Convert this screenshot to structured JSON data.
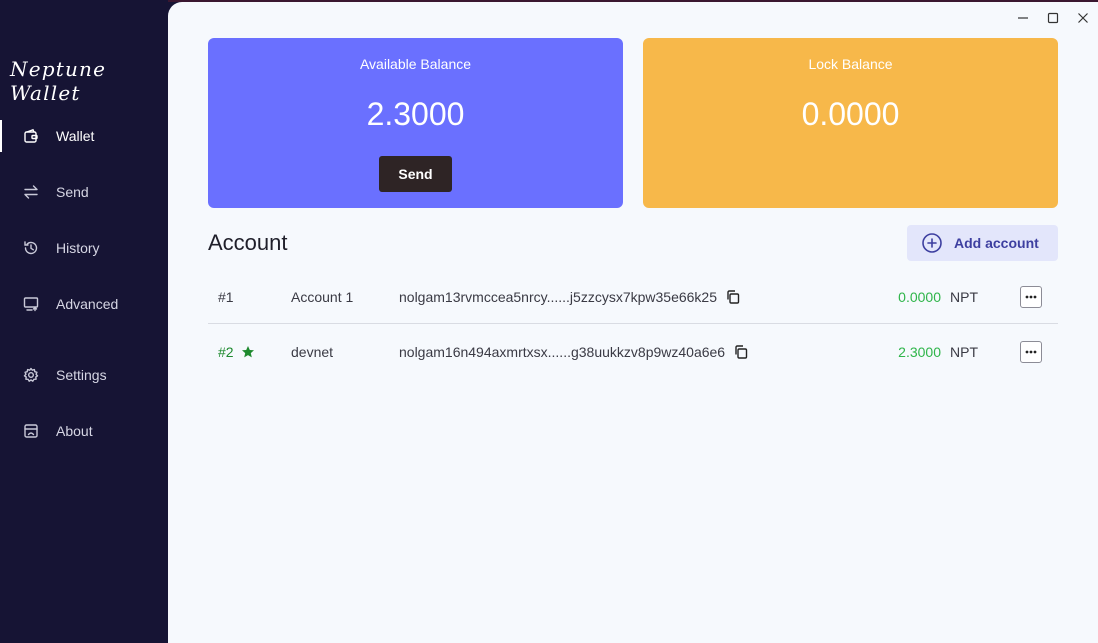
{
  "app": {
    "logo": "Neptune Wallet"
  },
  "sidebar": {
    "items": [
      {
        "label": "Wallet",
        "icon": "wallet-icon",
        "active": true
      },
      {
        "label": "Send",
        "icon": "transfer-arrows-icon"
      },
      {
        "label": "History",
        "icon": "history-icon"
      },
      {
        "label": "Advanced",
        "icon": "monitor-icon"
      },
      {
        "label": "Settings",
        "icon": "gear-icon"
      },
      {
        "label": "About",
        "icon": "about-icon"
      }
    ]
  },
  "window_controls": [
    "minimize-icon",
    "maximize-icon",
    "close-icon"
  ],
  "balances": {
    "available": {
      "title": "Available Balance",
      "amount": "2.3000",
      "send_label": "Send",
      "color": "#6a70ff"
    },
    "lock": {
      "title": "Lock Balance",
      "amount": "0.0000",
      "color": "#f7b84a"
    }
  },
  "accounts": {
    "title": "Account",
    "add_label": "Add account",
    "rows": [
      {
        "index": "#1",
        "name": "Account 1",
        "address": "nolgam13rvmccea5nrcy......j5zzcysx7kpw35e66k25",
        "balance": "0.0000",
        "unit": "NPT",
        "default": false
      },
      {
        "index": "#2",
        "name": "devnet",
        "address": "nolgam16n494axmrtxsx......g38uukkzv8p9wz40a6e6",
        "balance": "2.3000",
        "unit": "NPT",
        "default": true
      }
    ]
  },
  "colors": {
    "sidebar_bg": "#161434",
    "main_bg": "#f6f9fd",
    "positive": "#2fb54a",
    "default_account": "#1e8a2e",
    "accent": "#3d3fa0"
  }
}
